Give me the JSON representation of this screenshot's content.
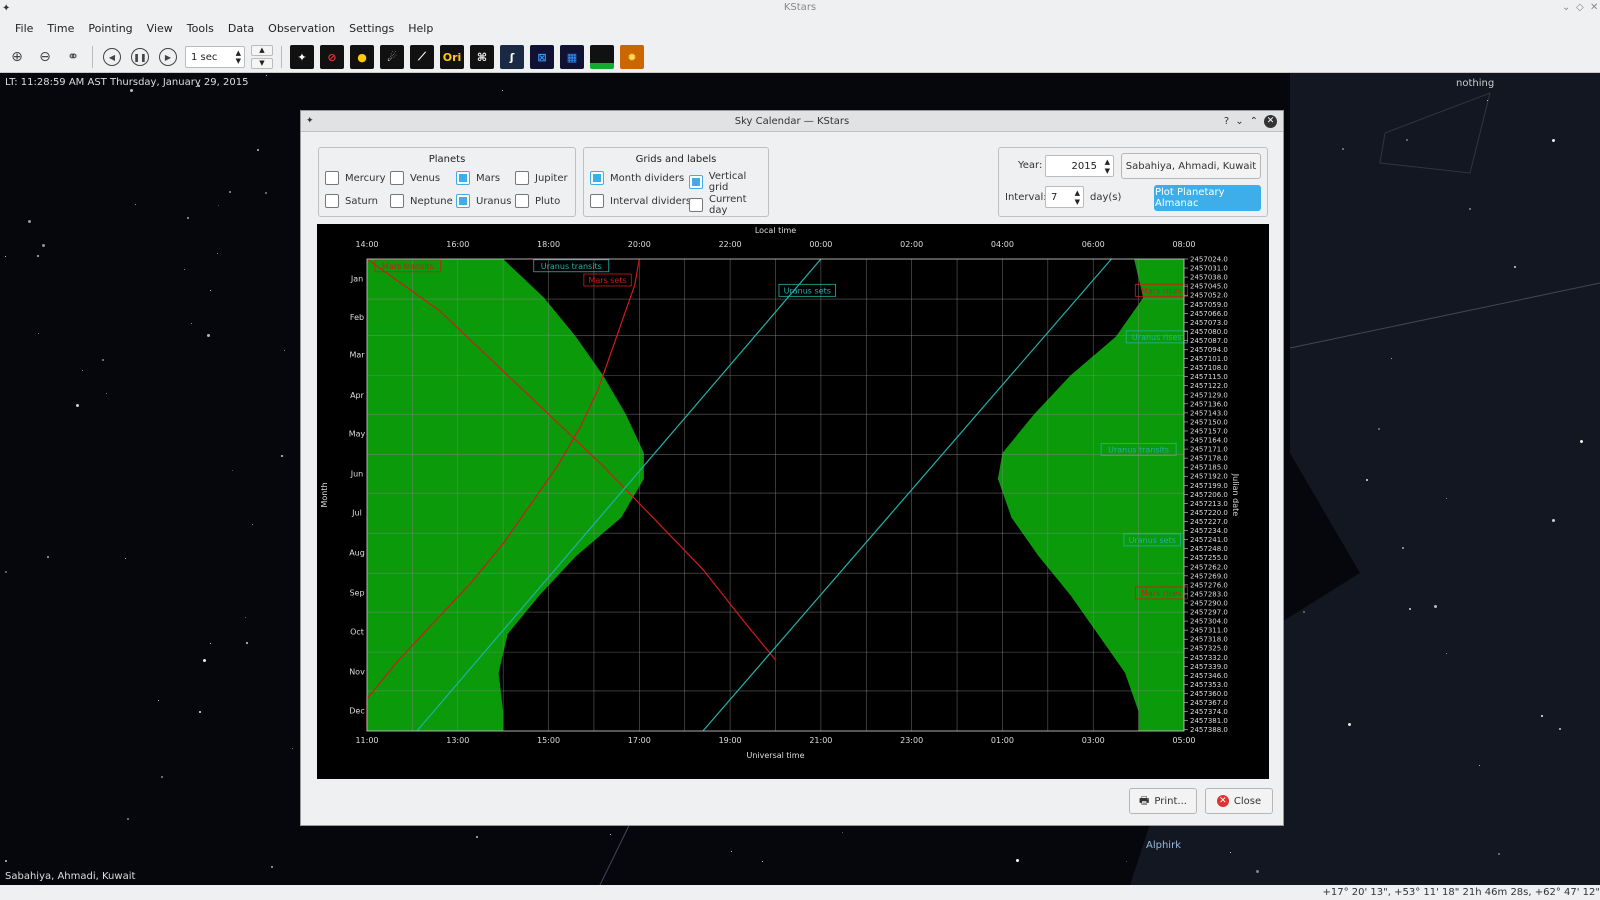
{
  "window": {
    "title": "KStars"
  },
  "menu": [
    "File",
    "Time",
    "Pointing",
    "View",
    "Tools",
    "Data",
    "Observation",
    "Settings",
    "Help"
  ],
  "toolbar": {
    "time_step": "1 sec",
    "ori_label": "Ori"
  },
  "sky": {
    "lt_label": "LT: 11:28:59 AM AST   Thursday, January 29, 2015",
    "focus_label": "nothing",
    "location_label": "Sabahiya, Ahmadi, Kuwait",
    "star_label": "Alphirk"
  },
  "status": {
    "coords": "+17° 20' 13\", +53° 11' 18\"   21h 46m 28s, +62° 47' 12\""
  },
  "dialog": {
    "title": "Sky Calendar — KStars",
    "planets_title": "Planets",
    "planets": [
      {
        "label": "Mercury",
        "checked": false
      },
      {
        "label": "Venus",
        "checked": false
      },
      {
        "label": "Mars",
        "checked": true
      },
      {
        "label": "Jupiter",
        "checked": false
      },
      {
        "label": "Saturn",
        "checked": false
      },
      {
        "label": "Neptune",
        "checked": false
      },
      {
        "label": "Uranus",
        "checked": true
      },
      {
        "label": "Pluto",
        "checked": false
      }
    ],
    "grids_title": "Grids and labels",
    "grids": [
      {
        "label": "Month dividers",
        "checked": true
      },
      {
        "label": "Vertical grid",
        "checked": true
      },
      {
        "label": "Interval dividers",
        "checked": false
      },
      {
        "label": "Current day",
        "checked": false
      }
    ],
    "year_label": "Year:",
    "year_value": "2015",
    "location_button": "Sabahiya, Ahmadi, Kuwait",
    "interval_label": "Interval:",
    "interval_value": "7",
    "interval_unit": "day(s)",
    "plot_button": "Plot Planetary Almanac",
    "print_button": "Print...",
    "close_button": "Close"
  },
  "chart_data": {
    "type": "line",
    "title": "",
    "top_axis_label": "Local time",
    "bottom_axis_label": "Universal time",
    "left_axis_label": "Month",
    "right_axis_label": "Julian date",
    "top_ticks": [
      "14:00",
      "16:00",
      "18:00",
      "20:00",
      "22:00",
      "00:00",
      "02:00",
      "04:00",
      "06:00",
      "08:00"
    ],
    "bottom_ticks": [
      "11:00",
      "13:00",
      "15:00",
      "17:00",
      "19:00",
      "21:00",
      "23:00",
      "01:00",
      "03:00",
      "05:00"
    ],
    "bottom_tick_hours": [
      11,
      13,
      15,
      17,
      19,
      21,
      23,
      25,
      27,
      29
    ],
    "x_range_ut_hours": [
      11,
      29
    ],
    "y_range_days": [
      0,
      365
    ],
    "months": [
      "Jan",
      "Feb",
      "Mar",
      "Apr",
      "May",
      "Jun",
      "Jul",
      "Aug",
      "Sep",
      "Oct",
      "Nov",
      "Dec"
    ],
    "julian_dates": [
      "2457024.0",
      "2457031.0",
      "2457038.0",
      "2457045.0",
      "2457052.0",
      "2457059.0",
      "2457066.0",
      "2457073.0",
      "2457080.0",
      "2457087.0",
      "2457094.0",
      "2457101.0",
      "2457108.0",
      "2457115.0",
      "2457122.0",
      "2457129.0",
      "2457136.0",
      "2457143.0",
      "2457150.0",
      "2457157.0",
      "2457164.0",
      "2457171.0",
      "2457178.0",
      "2457185.0",
      "2457192.0",
      "2457199.0",
      "2457206.0",
      "2457213.0",
      "2457220.0",
      "2457227.0",
      "2457234.0",
      "2457241.0",
      "2457248.0",
      "2457255.0",
      "2457262.0",
      "2457269.0",
      "2457276.0",
      "2457283.0",
      "2457290.0",
      "2457297.0",
      "2457304.0",
      "2457311.0",
      "2457318.0",
      "2457325.0",
      "2457332.0",
      "2457339.0",
      "2457346.0",
      "2457353.0",
      "2457360.0",
      "2457367.0",
      "2457374.0",
      "2457381.0",
      "2457388.0"
    ],
    "daylight_evening": {
      "days": [
        0,
        30,
        60,
        90,
        120,
        150,
        170,
        200,
        230,
        260,
        290,
        320,
        350,
        365
      ],
      "ut_hours": [
        14.0,
        14.9,
        15.6,
        16.2,
        16.7,
        17.1,
        17.1,
        16.6,
        15.6,
        14.8,
        14.1,
        13.9,
        14.0,
        14.0
      ]
    },
    "daylight_morning": {
      "days": [
        0,
        30,
        60,
        90,
        120,
        150,
        170,
        200,
        230,
        260,
        290,
        320,
        350,
        365
      ],
      "ut_hours": [
        27.9,
        28.1,
        27.5,
        26.5,
        25.7,
        25.0,
        24.9,
        25.2,
        25.8,
        26.5,
        27.1,
        27.7,
        28.0,
        28.0
      ]
    },
    "series": [
      {
        "name": "Mars",
        "color": "#d11a1a",
        "segments": [
          {
            "days": [
              0,
              15,
              40,
              80,
              120,
              160,
              200,
              240,
              280,
              310
            ],
            "ut_hours": [
              11.0,
              11.6,
              12.6,
              13.8,
              15.0,
              16.2,
              17.3,
              18.4,
              19.3,
              20.0
            ]
          },
          {
            "days": [
              0,
              20,
              40,
              70,
              100,
              130,
              160,
              190,
              220,
              250,
              280,
              310,
              340,
              365
            ],
            "ut_hours": [
              17.0,
              16.9,
              16.7,
              16.4,
              16.1,
              15.7,
              15.2,
              14.6,
              14.0,
              13.3,
              12.5,
              11.7,
              11.0,
              11.0
            ]
          }
        ]
      },
      {
        "name": "Uranus",
        "color": "#20b2aa",
        "segments": [
          {
            "days": [
              0,
              365
            ],
            "ut_hours": [
              21.0,
              12.1
            ]
          },
          {
            "days": [
              0,
              365
            ],
            "ut_hours": [
              27.4,
              18.4
            ]
          }
        ]
      }
    ],
    "annotations": [
      "Mars transits",
      "Uranus transits",
      "Mars sets",
      "Uranus sets",
      "Mars rises",
      "Uranus rises",
      "Uranus transits",
      "Uranus sets",
      "Mars rises"
    ]
  }
}
